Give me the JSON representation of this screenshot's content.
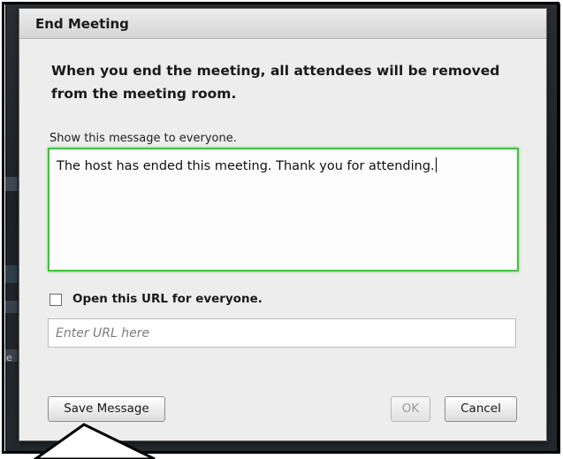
{
  "dialog": {
    "title": "End Meeting",
    "warning": "When you end the meeting, all attendees will be removed from the meeting room.",
    "show_label": "Show this message to everyone.",
    "message_value": "The host has ended this meeting. Thank you for attending.",
    "url_checkbox_label": "Open this URL for everyone.",
    "url_checked": false,
    "url_placeholder": "Enter URL here",
    "buttons": {
      "save": "Save Message",
      "ok": "OK",
      "cancel": "Cancel"
    }
  },
  "backdrop": {
    "edge_letter": "e"
  },
  "colors": {
    "focus_border": "#3fc43f",
    "dialog_bg": "#ededed",
    "disabled_text": "#9a9a9a"
  }
}
